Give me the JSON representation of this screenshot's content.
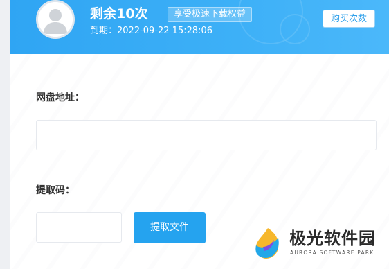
{
  "header": {
    "remaining_text": "剩余10次",
    "vip_badge": "享受极速下载权益",
    "expiry_text": "到期：2022-09-22 15:28:06",
    "buy_label": "购买次数"
  },
  "form": {
    "url_label": "网盘地址：",
    "url_value": "",
    "code_label": "提取码：",
    "code_value": "",
    "extract_label": "提取文件"
  },
  "brand": {
    "name": "极光软件园",
    "subtitle": "AURORA SOFTWARE PARK"
  },
  "colors": {
    "header_blue": "#2fa5f3",
    "button_blue": "#25a3ef"
  },
  "icons": {
    "avatar": "user-silhouette-icon",
    "logo": "aurora-logo-icon"
  }
}
